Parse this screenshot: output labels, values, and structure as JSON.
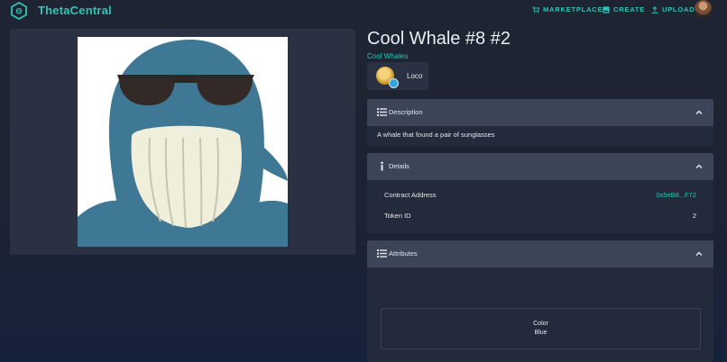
{
  "app": {
    "name": "ThetaCentral"
  },
  "nav": {
    "marketplace": "MARKETPLACE",
    "create": "CREATE",
    "upload": "UPLOAD"
  },
  "nft": {
    "title": "Cool Whale #8 #2",
    "collection": "Cool Whales",
    "owner": "Loco"
  },
  "description": {
    "header": "Description",
    "text": "A whale that found a pair of sunglasses"
  },
  "details": {
    "header": "Details",
    "contract_label": "Contract Address",
    "contract_value": "0x5eB8...F72",
    "token_label": "Token ID",
    "token_value": "2"
  },
  "attributes": {
    "header": "Attributes",
    "items": [
      {
        "trait_type": "Color",
        "value": "Blue"
      }
    ]
  },
  "colors": {
    "accent": "#2ec4b6",
    "background": "#1f2432",
    "panel": "#2b3142",
    "card_header": "#3c4458"
  }
}
